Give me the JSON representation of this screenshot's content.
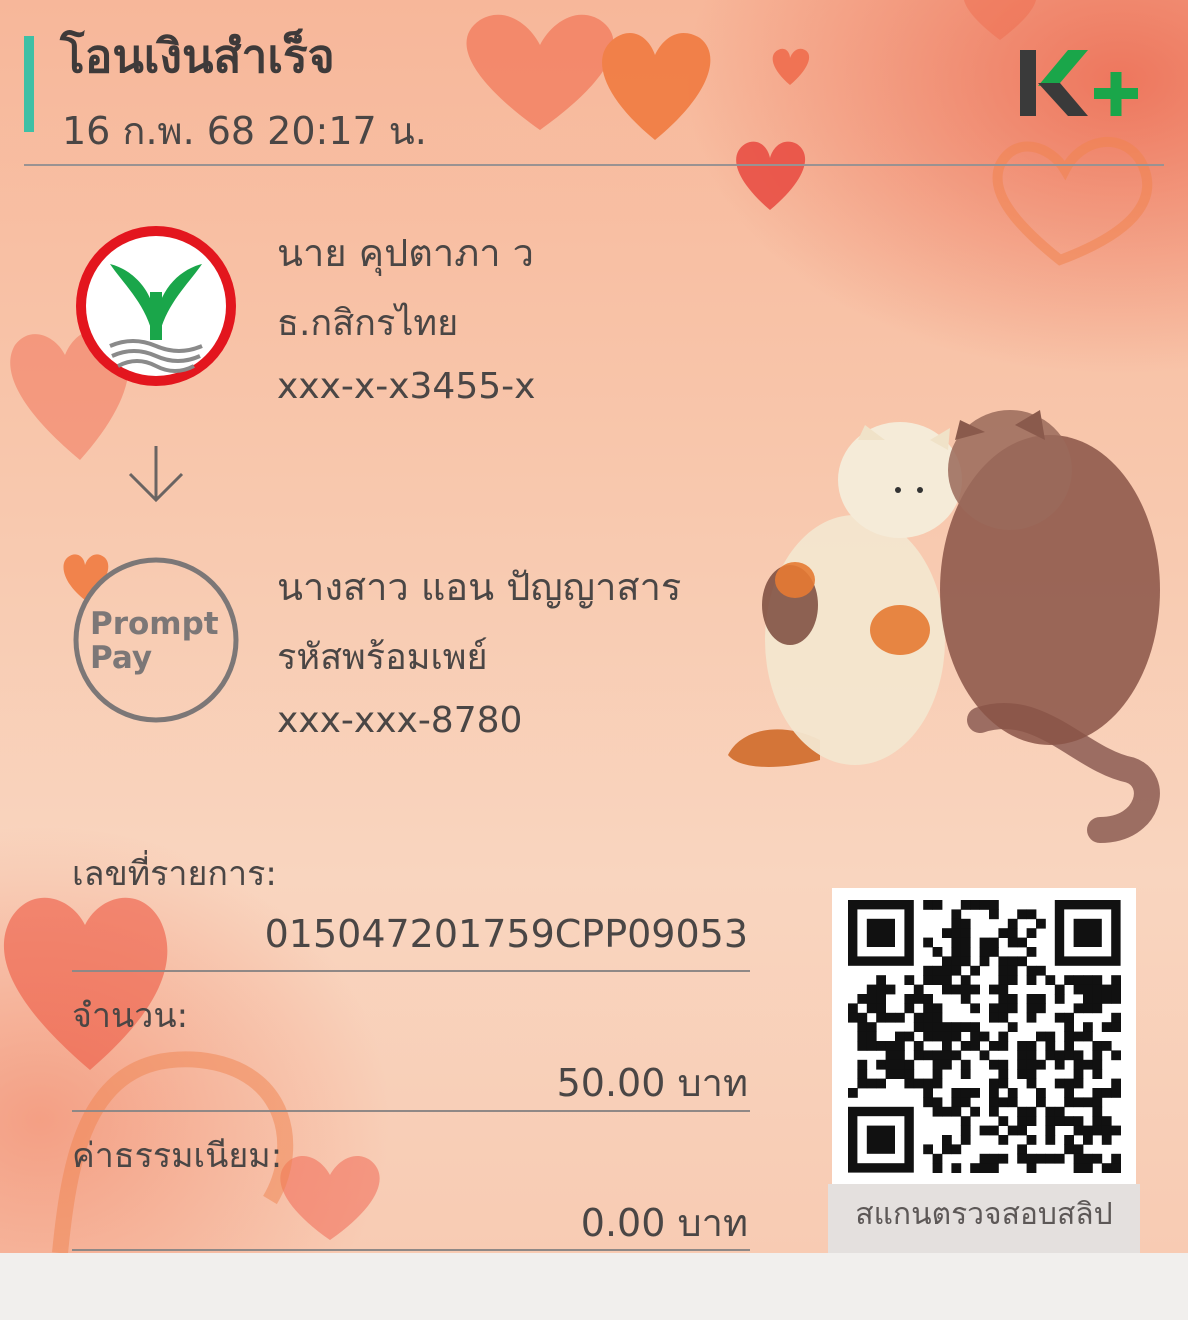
{
  "header": {
    "title": "โอนเงินสำเร็จ",
    "datetime": "16 ก.พ. 68  20:17 น.",
    "app_logo": "K+"
  },
  "sender": {
    "name": "นาย คุปตาภา ว",
    "bank": "ธ.กสิกรไทย",
    "account": "xxx-x-x3455-x",
    "logo_icon": "kasikorn-bank-logo-icon"
  },
  "receiver": {
    "name": "นางสาว แอน ปัญญาสาร",
    "channel": "รหัสพร้อมเพย์",
    "account": "xxx-xxx-8780",
    "logo_line1": "Prompt",
    "logo_line2": "Pay"
  },
  "transaction": {
    "ref_label": "เลขที่รายการ:",
    "ref_value": "015047201759CPP09053",
    "amount_label": "จำนวน:",
    "amount_value": "50.00 บาท",
    "fee_label": "ค่าธรรมเนียม:",
    "fee_value": "0.00 บาท"
  },
  "qr": {
    "caption": "สแกนตรวจสอบสลิป"
  },
  "colors": {
    "accent": "#3ec0a5",
    "kbank_green": "#1aa64a",
    "kbank_red": "#e3161e",
    "background_top": "#f7b79a",
    "background_bottom": "#f9d5bf"
  }
}
